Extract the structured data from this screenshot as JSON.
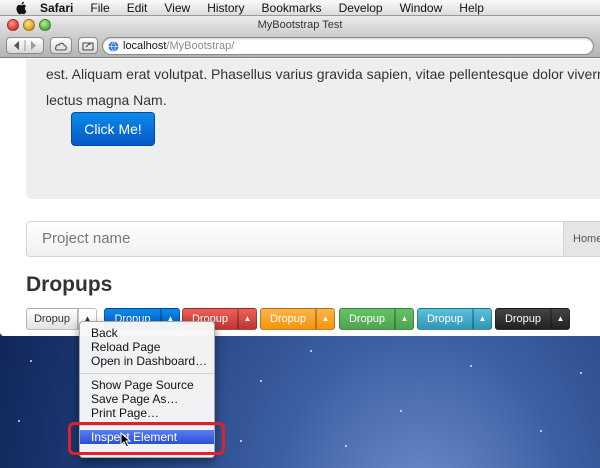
{
  "menubar": {
    "app": "Safari",
    "items": [
      "File",
      "Edit",
      "View",
      "History",
      "Bookmarks",
      "Develop",
      "Window",
      "Help"
    ]
  },
  "window": {
    "title": "MyBootstrap Test",
    "address_host": "localhost",
    "address_path": "/MyBootstrap/"
  },
  "page": {
    "hero_line1": "est. Aliquam erat volutpat. Phasellus varius gravida sapien, vitae pellentesque dolor viverra id.",
    "hero_line2": "lectus magna Nam.",
    "click_button": "Click Me!",
    "project_name": "Project name",
    "project_home": "Home",
    "section_title": "Dropups",
    "dropup_label": "Dropup",
    "dropup_caret": "▲"
  },
  "context_menu": {
    "items": [
      "Back",
      "Reload Page",
      "Open in Dashboard…",
      "Show Page Source",
      "Save Page As…",
      "Print Page…",
      "Inspect Element"
    ],
    "highlighted": "Inspect Element"
  },
  "colors": {
    "accent": "#0a8ae6",
    "danger": "#ee5f5b",
    "warning": "#f89406",
    "success": "#51a351",
    "info": "#2f96b4",
    "inverse": "#222222",
    "highlight_box": "#e0202a"
  }
}
